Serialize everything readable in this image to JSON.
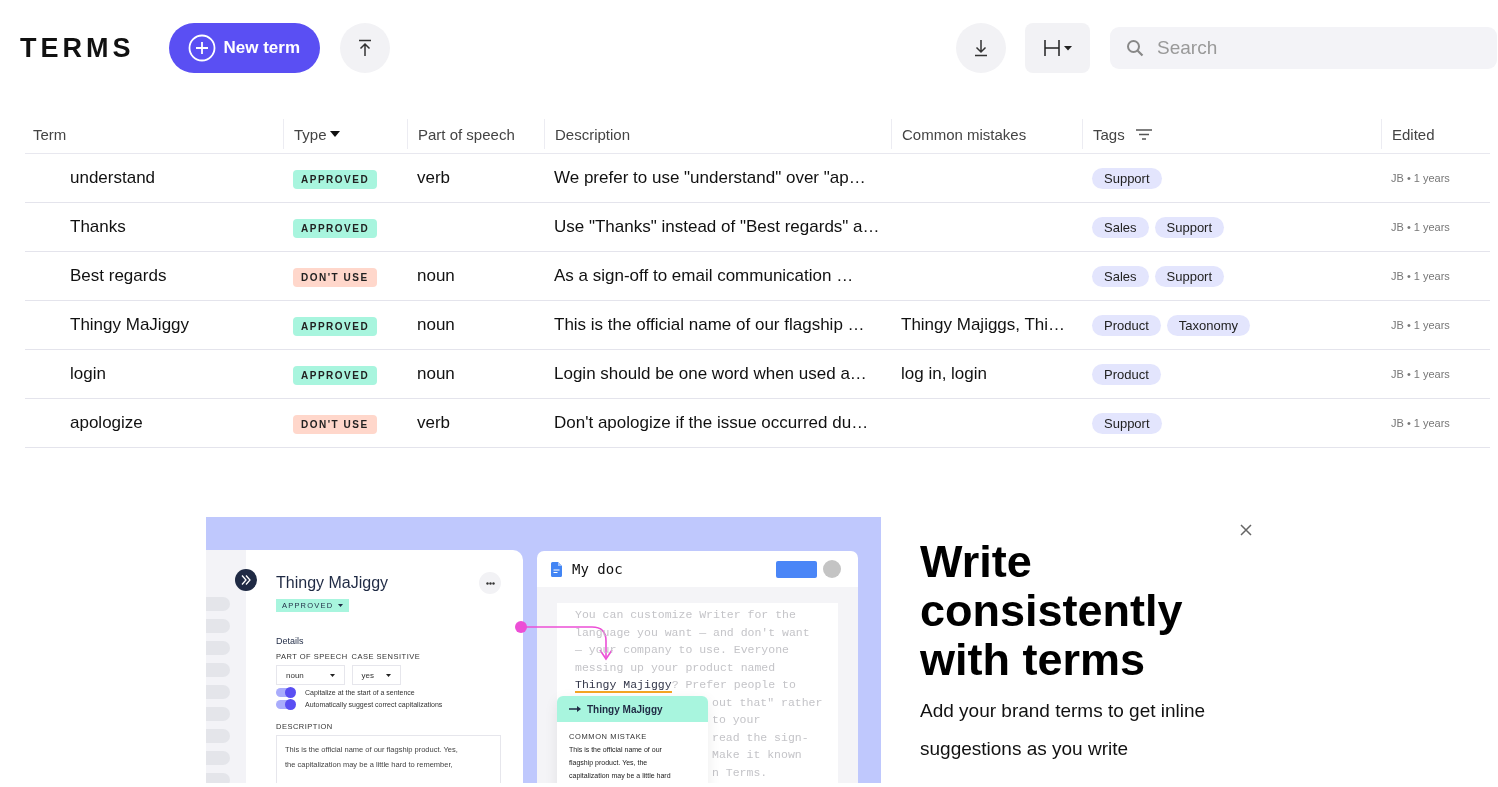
{
  "app": {
    "logo": "TERMS"
  },
  "toolbar": {
    "new_button": "New term",
    "search": {
      "placeholder": "Search"
    }
  },
  "table": {
    "columns": [
      {
        "label": "Term",
        "kind": "plain"
      },
      {
        "label": "Type",
        "kind": "sort"
      },
      {
        "label": "Part of speech",
        "kind": "plain"
      },
      {
        "label": "Description",
        "kind": "plain"
      },
      {
        "label": "Common mistakes",
        "kind": "plain"
      },
      {
        "label": "Tags",
        "kind": "filter"
      },
      {
        "label": "Edited",
        "kind": "plain"
      }
    ],
    "rows": [
      {
        "term": "understand",
        "type": {
          "kind": "approved",
          "label": "APPROVED"
        },
        "part_of_speech": "verb",
        "description": "We prefer to use \"understand\" over \"ap…",
        "common_mistakes": "",
        "tags": [
          "Support"
        ],
        "edited": "JB • 1 years"
      },
      {
        "term": "Thanks",
        "type": {
          "kind": "approved",
          "label": "APPROVED"
        },
        "part_of_speech": "",
        "description": "Use \"Thanks\" instead of \"Best regards\" a…",
        "common_mistakes": "",
        "tags": [
          "Sales",
          "Support"
        ],
        "edited": "JB • 1 years"
      },
      {
        "term": "Best regards",
        "type": {
          "kind": "avoid",
          "label": "DON'T USE"
        },
        "part_of_speech": "noun",
        "description": "As a sign-off to email communication …",
        "common_mistakes": "",
        "tags": [
          "Sales",
          "Support"
        ],
        "edited": "JB • 1 years"
      },
      {
        "term": "Thingy MaJiggy",
        "type": {
          "kind": "approved",
          "label": "APPROVED"
        },
        "part_of_speech": "noun",
        "description": "This is the official name of our flagship …",
        "common_mistakes": "Thingy Majiggs, Thi…",
        "tags": [
          "Product",
          "Taxonomy"
        ],
        "edited": "JB • 1 years"
      },
      {
        "term": "login",
        "type": {
          "kind": "approved",
          "label": "APPROVED"
        },
        "part_of_speech": "noun",
        "description": "Login should be one word when used a…",
        "common_mistakes": "log in, login",
        "tags": [
          "Product"
        ],
        "edited": "JB • 1 years"
      },
      {
        "term": "apologize",
        "type": {
          "kind": "avoid",
          "label": "DON'T USE"
        },
        "part_of_speech": "verb",
        "description": "Don't apologize if the issue occurred du…",
        "common_mistakes": "",
        "tags": [
          "Support"
        ],
        "edited": "JB • 1 years"
      }
    ]
  },
  "promo": {
    "illustration": {
      "term_card": {
        "title": "Thingy MaJiggy",
        "status": "APPROVED",
        "section": "Details",
        "fields": [
          {
            "label": "PART OF SPEECH",
            "value": "noun"
          },
          {
            "label": "CASE SENSITIVE",
            "value": "yes"
          }
        ],
        "toggles": [
          {
            "label": "Capitalize at the start of a sentence",
            "on": true
          },
          {
            "label": "Automatically suggest correct capitalizations",
            "on": true
          }
        ],
        "description_label": "DESCRIPTION",
        "description_lines": [
          "This is the official name of our flagship product. Yes,",
          "the capitalization may be a little hard to remember,"
        ]
      },
      "doc": {
        "title": "My doc",
        "lines": [
          {
            "text": "You can customize Writer for the",
            "covered": false
          },
          {
            "text": "language you want — and don't want",
            "covered": false
          },
          {
            "text": "— your company to use. Everyone",
            "covered": false
          },
          {
            "text": "messing up your product named",
            "covered": false
          },
          {
            "flagged": "Thingy Majiggy",
            "text": "? Prefer people to",
            "covered": false
          },
          {
            "text": "out that\" rather",
            "covered": true
          },
          {
            "text": "to your",
            "covered": true
          },
          {
            "text": "read the sign-",
            "covered": true
          },
          {
            "text": "Make it known",
            "covered": true
          },
          {
            "text": "n Terms.",
            "covered": true
          }
        ]
      },
      "suggestion": {
        "term": "Thingy MaJiggy",
        "label": "COMMON MISTAKE",
        "lines": [
          "This is the official name of our",
          "flagship product. Yes, the",
          "capitalization may be a little hard"
        ]
      }
    },
    "heading": "Write consistently with terms",
    "subtitle": "Add your brand terms to get inline suggestions as you write"
  }
}
